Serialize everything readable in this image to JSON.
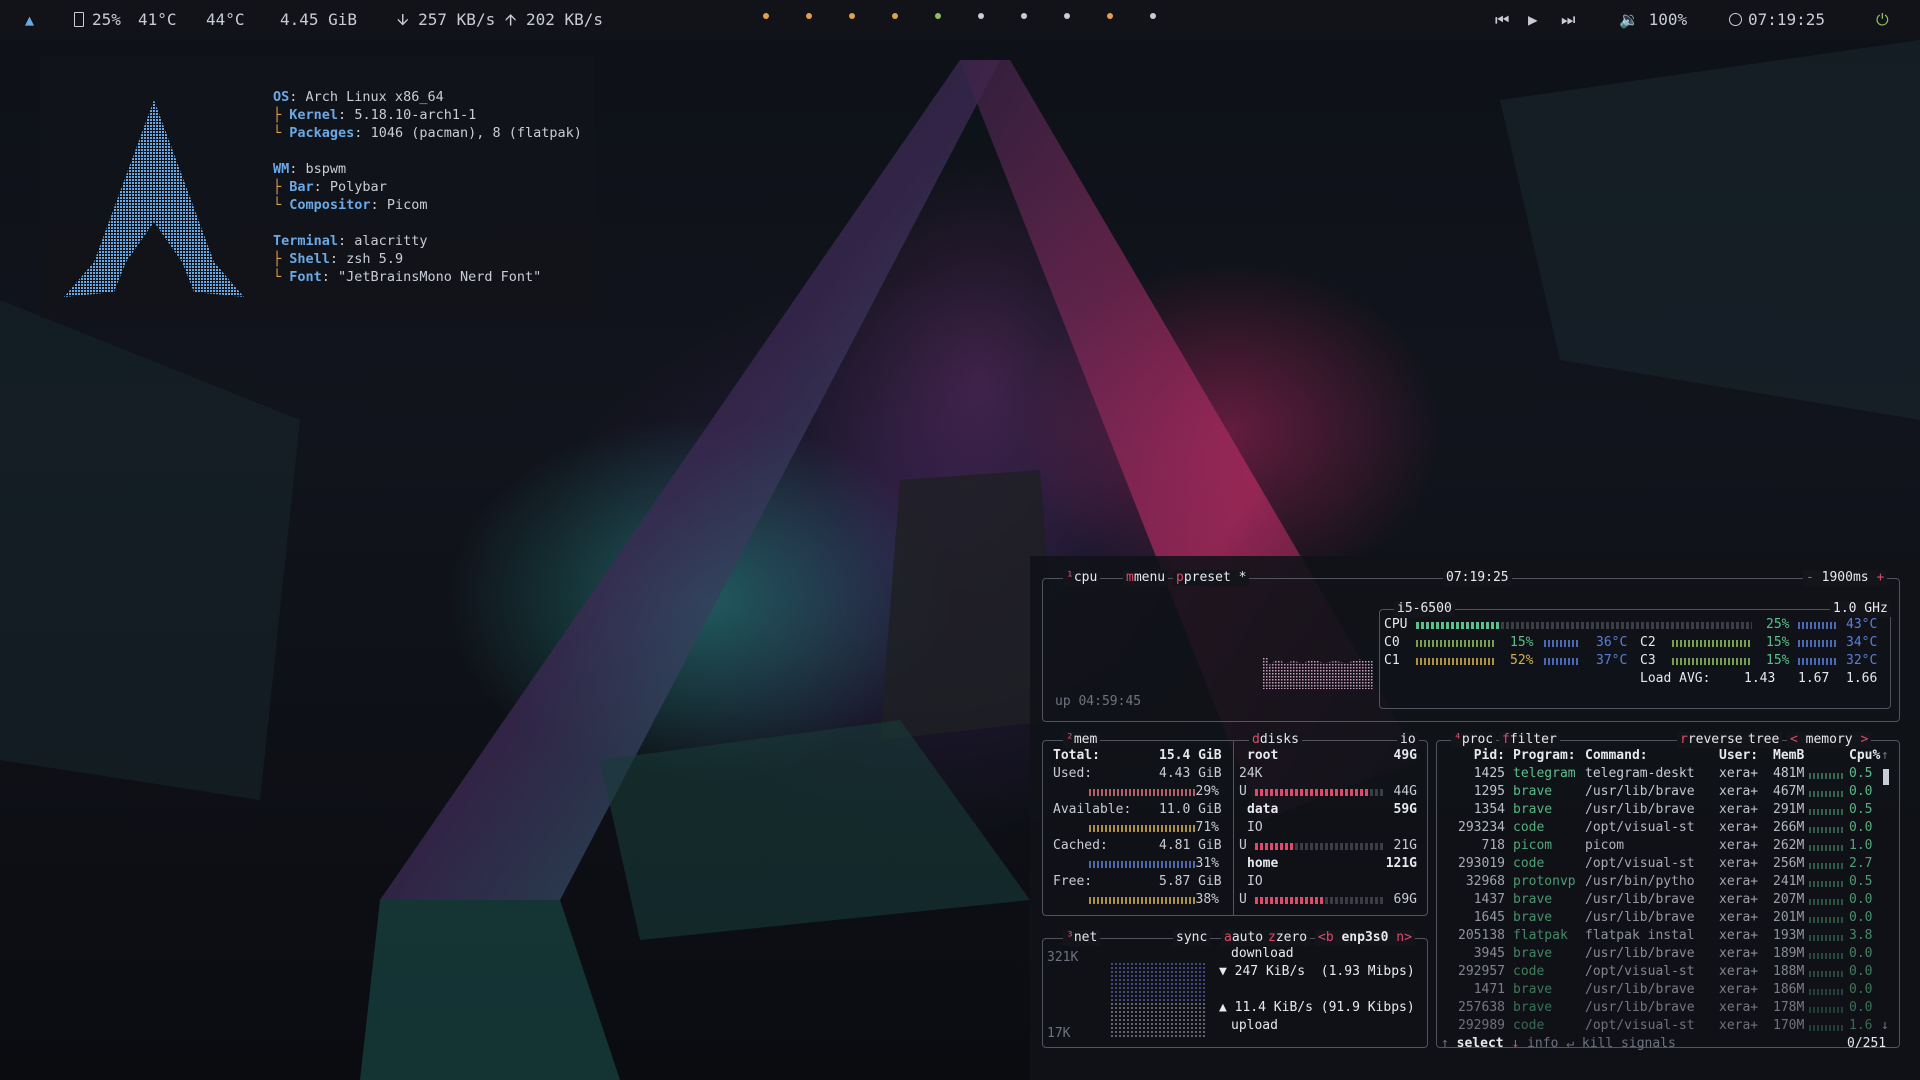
{
  "topbar": {
    "logo": "arch-logo",
    "battery": "25%",
    "cpu_temp": "41°C",
    "gpu_temp": "44°C",
    "memory": "4.45 GiB",
    "down_speed": "257 KB/s",
    "up_speed": "202 KB/s",
    "workspaces": [
      {
        "color": "#e0a050"
      },
      {
        "color": "#e0a050"
      },
      {
        "color": "#e0a050"
      },
      {
        "color": "#e0a050"
      },
      {
        "color": "#8fc060"
      },
      {
        "color": "#c9ccd6"
      },
      {
        "color": "#c9ccd6"
      },
      {
        "color": "#c9ccd6"
      },
      {
        "color": "#e0a050"
      },
      {
        "color": "#c9ccd6"
      }
    ],
    "volume": "100%",
    "clock": "07:19:25"
  },
  "fetch": {
    "os_label": "OS",
    "os": "Arch Linux x86_64",
    "kernel_label": "Kernel",
    "kernel": "5.18.10-arch1-1",
    "packages_label": "Packages",
    "packages": "1046 (pacman), 8 (flatpak)",
    "wm_label": "WM",
    "wm": "bspwm",
    "bar_label": "Bar",
    "bar": "Polybar",
    "compositor_label": "Compositor",
    "compositor": "Picom",
    "terminal_label": "Terminal",
    "terminal": "alacritty",
    "shell_label": "Shell",
    "shell": "zsh 5.9",
    "font_label": "Font",
    "font": "\"JetBrainsMono Nerd Font\""
  },
  "btop": {
    "cpu": {
      "title": "cpu",
      "menu": "menu",
      "preset": "preset *",
      "clock": "07:19:25",
      "interval": "1900ms",
      "uptime": "up 04:59:45",
      "model": "i5-6500",
      "freq": "1.0 GHz",
      "total_label": "CPU",
      "total_pct": "25%",
      "total_temp": "43°C",
      "total_level": 0.25,
      "cores": [
        {
          "name": "C0",
          "pct": "15%",
          "temp": "36°C"
        },
        {
          "name": "C1",
          "pct": "52%",
          "temp": "37°C"
        },
        {
          "name": "C2",
          "pct": "15%",
          "temp": "34°C"
        },
        {
          "name": "C3",
          "pct": "15%",
          "temp": "32°C"
        }
      ],
      "load_label": "Load AVG:",
      "load": [
        "1.43",
        "1.67",
        "1.66"
      ]
    },
    "mem": {
      "title": "mem",
      "total_label": "Total:",
      "total": "15.4 GiB",
      "used_label": "Used:",
      "used": "4.43 GiB",
      "used_pct": "29%",
      "avail_label": "Available:",
      "avail": "11.0 GiB",
      "avail_pct": "71%",
      "cached_label": "Cached:",
      "cached": "4.81 GiB",
      "cached_pct": "31%",
      "free_label": "Free:",
      "free": "5.87 GiB",
      "free_pct": "38%"
    },
    "disks": {
      "title": "disks",
      "io": "io",
      "items": [
        {
          "name": "root",
          "size": "49G",
          "sub": "24K",
          "used": "44G",
          "level": 0.9
        },
        {
          "name": "data",
          "size": "59G",
          "sub": "IO",
          "used": "21G",
          "level": 0.3
        },
        {
          "name": "home",
          "size": "121G",
          "sub": "IO",
          "used": "69G",
          "level": 0.55
        }
      ],
      "u": "U"
    },
    "net": {
      "title": "net",
      "sync": "sync",
      "auto": "auto",
      "zero": "zero",
      "prev": "<b",
      "iface": "enp3s0",
      "next": "n>",
      "top_scale": "321K",
      "bottom_scale": "17K",
      "download_label": "download",
      "download": "247 KiB/s",
      "download_bits": "(1.93 Mibps)",
      "upload": "11.4 KiB/s",
      "upload_bits": "(91.9 Kibps)",
      "upload_label": "upload"
    },
    "proc": {
      "title": "proc",
      "filter": "filter",
      "reverse": "reverse",
      "tree": "tree",
      "sort_prev": "<",
      "sort": "memory",
      "sort_next": ">",
      "headers": {
        "pid": "Pid:",
        "program": "Program:",
        "command": "Command:",
        "user": "User:",
        "mem": "MemB",
        "cpu": "Cpu%"
      },
      "rows": [
        {
          "pid": "1425",
          "program": "telegram",
          "command": "telegram-deskt",
          "user": "xera+",
          "mem": "481M",
          "cpu": "0.5"
        },
        {
          "pid": "1295",
          "program": "brave",
          "command": "/usr/lib/brave",
          "user": "xera+",
          "mem": "467M",
          "cpu": "0.0"
        },
        {
          "pid": "1354",
          "program": "brave",
          "command": "/usr/lib/brave",
          "user": "xera+",
          "mem": "291M",
          "cpu": "0.5"
        },
        {
          "pid": "293234",
          "program": "code",
          "command": "/opt/visual-st",
          "user": "xera+",
          "mem": "266M",
          "cpu": "0.0"
        },
        {
          "pid": "718",
          "program": "picom",
          "command": "picom",
          "user": "xera+",
          "mem": "262M",
          "cpu": "1.0"
        },
        {
          "pid": "293019",
          "program": "code",
          "command": "/opt/visual-st",
          "user": "xera+",
          "mem": "256M",
          "cpu": "2.7"
        },
        {
          "pid": "32968",
          "program": "protonvp",
          "command": "/usr/bin/pytho",
          "user": "xera+",
          "mem": "241M",
          "cpu": "0.5"
        },
        {
          "pid": "1437",
          "program": "brave",
          "command": "/usr/lib/brave",
          "user": "xera+",
          "mem": "207M",
          "cpu": "0.0"
        },
        {
          "pid": "1645",
          "program": "brave",
          "command": "/usr/lib/brave",
          "user": "xera+",
          "mem": "201M",
          "cpu": "0.0"
        },
        {
          "pid": "205138",
          "program": "flatpak",
          "command": "flatpak instal",
          "user": "xera+",
          "mem": "193M",
          "cpu": "3.8"
        },
        {
          "pid": "3945",
          "program": "brave",
          "command": "/usr/lib/brave",
          "user": "xera+",
          "mem": "189M",
          "cpu": "0.0"
        },
        {
          "pid": "292957",
          "program": "code",
          "command": "/opt/visual-st",
          "user": "xera+",
          "mem": "188M",
          "cpu": "0.0"
        },
        {
          "pid": "1471",
          "program": "brave",
          "command": "/usr/lib/brave",
          "user": "xera+",
          "mem": "186M",
          "cpu": "0.0"
        },
        {
          "pid": "257638",
          "program": "brave",
          "command": "/usr/lib/brave",
          "user": "xera+",
          "mem": "178M",
          "cpu": "0.0"
        },
        {
          "pid": "292989",
          "program": "code",
          "command": "/opt/visual-st",
          "user": "xera+",
          "mem": "170M",
          "cpu": "1.6"
        }
      ],
      "footer": {
        "select": "select",
        "info": "info",
        "kill": "kill",
        "signals": "signals",
        "count": "0/251"
      }
    }
  }
}
